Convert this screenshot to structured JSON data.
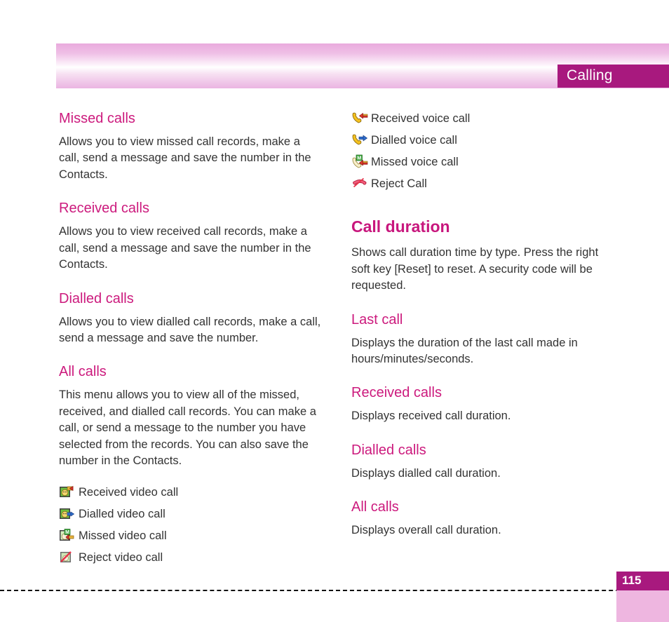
{
  "header": {
    "chapter_tab_label": "Calling",
    "accent_magenta": "#a8197e",
    "heading_pink": "#cc1a7d",
    "band_pink": "#e9aadd"
  },
  "left_column": {
    "sections": [
      {
        "heading": "Missed calls",
        "body": "Allows you to view missed call records, make a call, send a message and save the number in the Contacts."
      },
      {
        "heading": "Received calls",
        "body": "Allows you to view received call records, make a call, send a message and save the number in the Contacts."
      },
      {
        "heading": "Dialled calls",
        "body": "Allows you to view dialled call records, make a call, send a message and save the number."
      },
      {
        "heading": "All calls",
        "body": "This menu allows you to view all of the missed, received, and dialled call records. You can make a call, or send a message to the number you have selected from the records. You can also save the number in the Contacts."
      }
    ],
    "icon_legend": [
      {
        "icon": "received-video-call-icon",
        "label": "Received video call"
      },
      {
        "icon": "dialled-video-call-icon",
        "label": "Dialled video call"
      },
      {
        "icon": "missed-video-call-icon",
        "label": "Missed video call"
      },
      {
        "icon": "reject-video-call-icon",
        "label": "Reject video call"
      }
    ]
  },
  "right_column": {
    "icon_legend": [
      {
        "icon": "received-voice-call-icon",
        "label": "Received voice call"
      },
      {
        "icon": "dialled-voice-call-icon",
        "label": "Dialled voice call"
      },
      {
        "icon": "missed-voice-call-icon",
        "label": "Missed voice call"
      },
      {
        "icon": "reject-call-icon",
        "label": "Reject Call"
      }
    ],
    "call_duration": {
      "heading": "Call duration",
      "body": "Shows call duration time by type. Press the right soft key [Reset] to reset. A security code will be requested."
    },
    "sections": [
      {
        "heading": "Last call",
        "body": "Displays the duration of the last call made in hours/minutes/seconds."
      },
      {
        "heading": "Received calls",
        "body": "Displays received call duration."
      },
      {
        "heading": "Dialled calls",
        "body": "Displays dialled call duration."
      },
      {
        "heading": "All calls",
        "body": "Displays overall call duration."
      }
    ]
  },
  "footer": {
    "page_number": "115"
  }
}
